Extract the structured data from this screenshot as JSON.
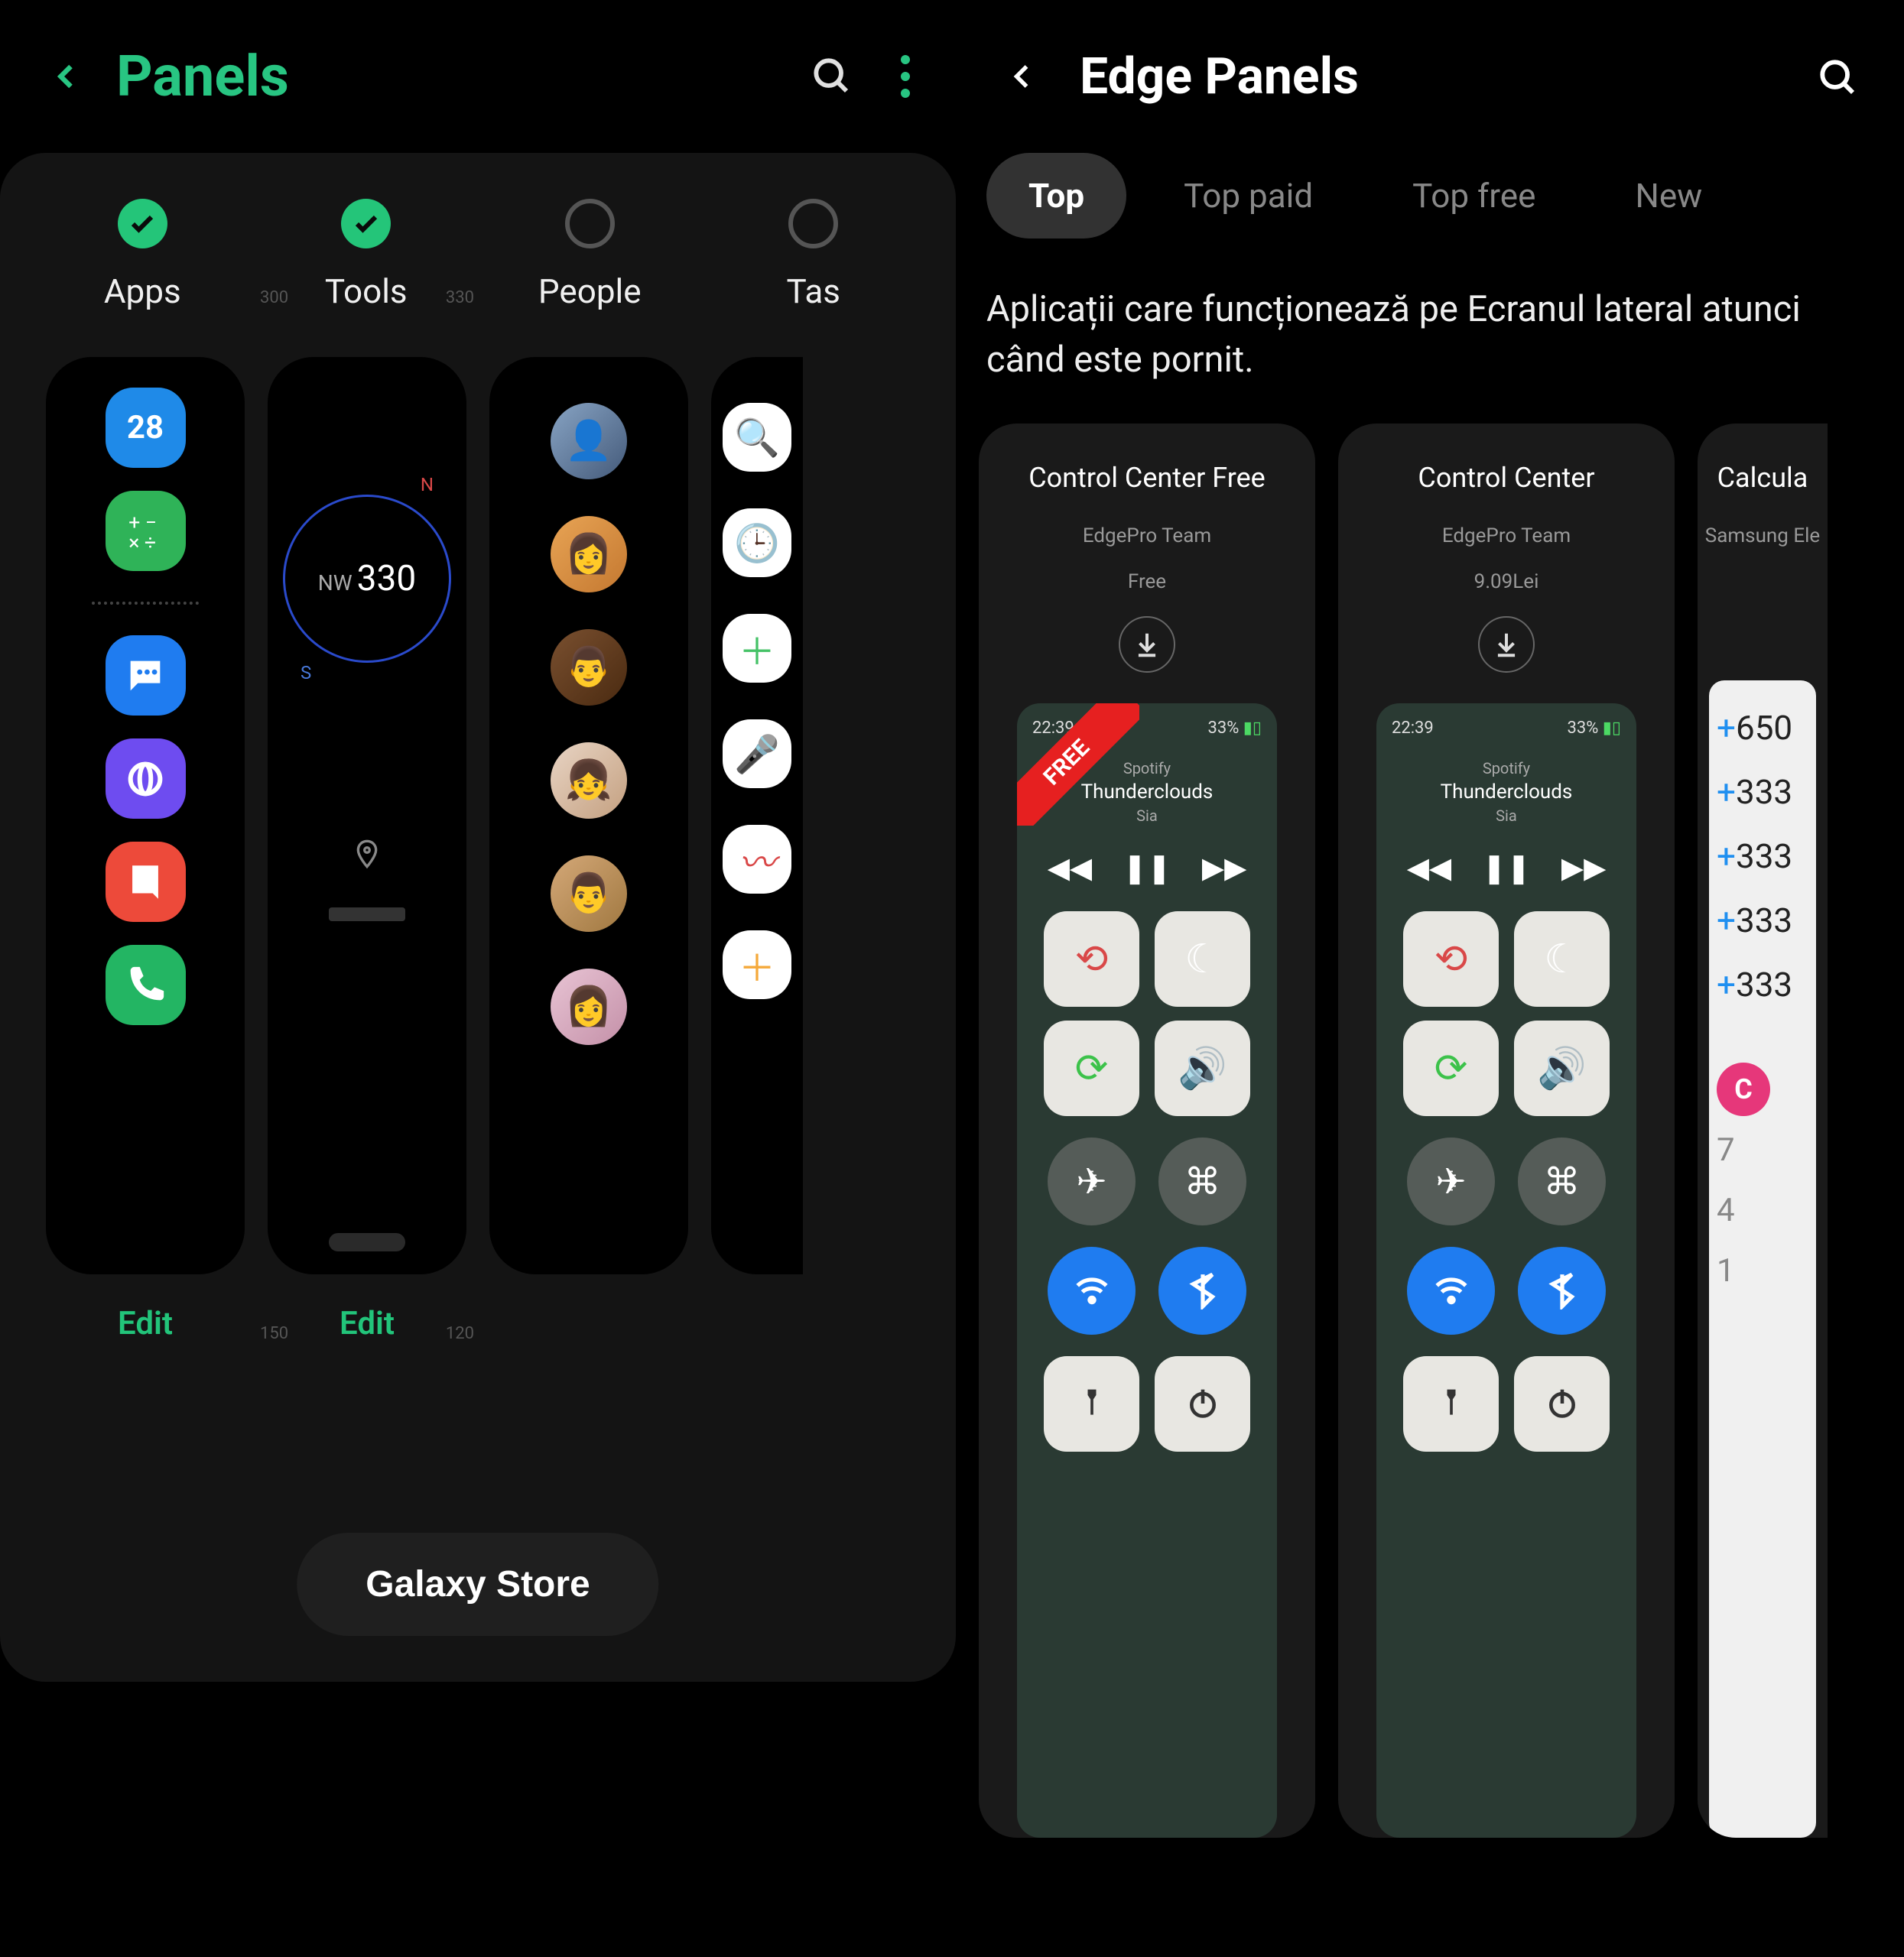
{
  "left": {
    "title": "Panels",
    "tabs": [
      {
        "label": "Apps",
        "checked": true,
        "edit": "Edit"
      },
      {
        "label": "Tools",
        "checked": true,
        "edit": "Edit"
      },
      {
        "label": "People",
        "checked": false
      },
      {
        "label": "Tas",
        "checked": false
      }
    ],
    "apps_calendar_day": "28",
    "compass": {
      "direction": "NW",
      "degrees": "330",
      "ticks_top": [
        "300",
        "330"
      ],
      "ticks_bottom": [
        "150",
        "120"
      ],
      "n": "N",
      "s": "S"
    },
    "store_button": "Galaxy Store"
  },
  "right": {
    "title": "Edge Panels",
    "filters": [
      "Top",
      "Top paid",
      "Top free",
      "New"
    ],
    "active_filter": 0,
    "description": "Aplicații care funcționează pe Ecranul lateral atunci când este pornit.",
    "cards": [
      {
        "title": "Control Center Free",
        "dev": "EdgePro Team",
        "price": "Free",
        "ribbon": "FREE",
        "status_time": "22:39",
        "status_batt": "33%",
        "music_app": "Spotify",
        "music_track": "Thunderclouds",
        "music_artist": "Sia"
      },
      {
        "title": "Control Center",
        "dev": "EdgePro Team",
        "price": "9.09Lei",
        "status_time": "22:39",
        "status_batt": "33%",
        "music_app": "Spotify",
        "music_track": "Thunderclouds",
        "music_artist": "Sia"
      },
      {
        "title": "Calcula",
        "dev": "Samsung Ele",
        "price": "",
        "calc_lines": [
          "+650",
          "+333",
          "+333",
          "+333",
          "+333"
        ],
        "calc_c": "C",
        "calc_nums": [
          "7",
          "4",
          "1"
        ]
      }
    ]
  }
}
